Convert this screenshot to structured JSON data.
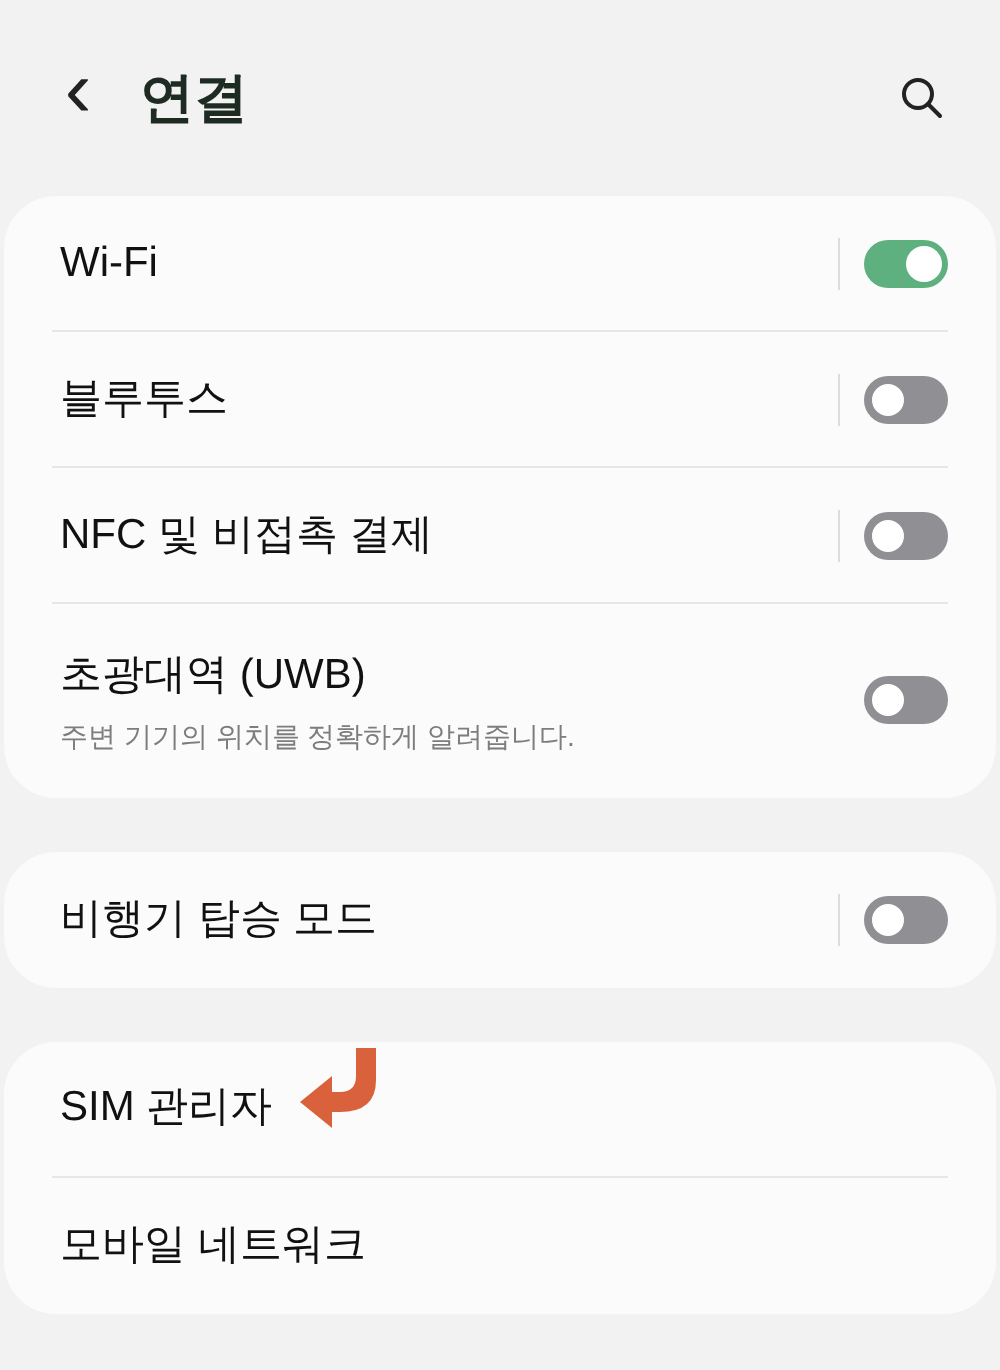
{
  "header": {
    "back": "‹",
    "title": "연결"
  },
  "sections": [
    {
      "items": [
        {
          "kind": "toggle",
          "title": "Wi-Fi",
          "on": true,
          "divider": true
        },
        {
          "kind": "toggle",
          "title": "블루투스",
          "on": false,
          "divider": true
        },
        {
          "kind": "toggle",
          "title": "NFC 및 비접촉 결제",
          "on": false,
          "divider": true
        },
        {
          "kind": "toggle",
          "title": "초광대역 (UWB)",
          "subtitle": "주변 기기의 위치를 정확하게 알려줍니다.",
          "on": false,
          "divider": false
        }
      ]
    },
    {
      "items": [
        {
          "kind": "toggle",
          "title": "비행기 탑승 모드",
          "on": false,
          "divider": true
        }
      ]
    },
    {
      "items": [
        {
          "kind": "link",
          "title": "SIM 관리자",
          "annotated": true
        },
        {
          "kind": "link",
          "title": "모바일 네트워크",
          "annotated": false
        }
      ]
    }
  ]
}
